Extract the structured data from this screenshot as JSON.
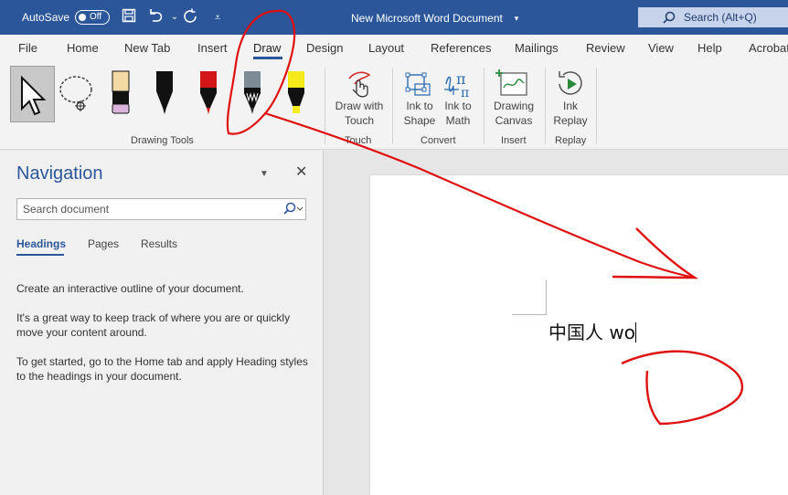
{
  "titlebar": {
    "autosave_label": "AutoSave",
    "toggle_state": "Off",
    "document_title": "New Microsoft Word Document",
    "search_label": "Search (Alt+Q)"
  },
  "ribbon_tabs": [
    "File",
    "Home",
    "New Tab",
    "Insert",
    "Draw",
    "Design",
    "Layout",
    "References",
    "Mailings",
    "Review",
    "View",
    "Help",
    "Acrobat"
  ],
  "active_tab": "Draw",
  "ribbon": {
    "drawing_tools_label": "Drawing Tools",
    "touch_group_label": "Touch",
    "draw_with_touch": [
      "Draw with",
      "Touch"
    ],
    "convert_group_label": "Convert",
    "ink_to_shape": [
      "Ink to",
      "Shape"
    ],
    "ink_to_math": [
      "Ink to",
      "Math"
    ],
    "insert_group_label": "Insert",
    "drawing_canvas": [
      "Drawing",
      "Canvas"
    ],
    "replay_group_label": "Replay",
    "ink_replay": [
      "Ink",
      "Replay"
    ]
  },
  "navigation": {
    "title": "Navigation",
    "search_placeholder": "Search document",
    "tabs": [
      "Headings",
      "Pages",
      "Results"
    ],
    "active_tab": "Headings",
    "paragraphs": [
      "Create an interactive outline of your document.",
      "It's a great way to keep track of where you are or quickly move your content around.",
      "To get started, go to the Home tab and apply Heading styles to the headings in your document."
    ]
  },
  "document": {
    "text": "中国人 wo"
  },
  "colors": {
    "titlebar": "#2b579a",
    "accent": "#2b579a",
    "annotation": "#e01010"
  }
}
